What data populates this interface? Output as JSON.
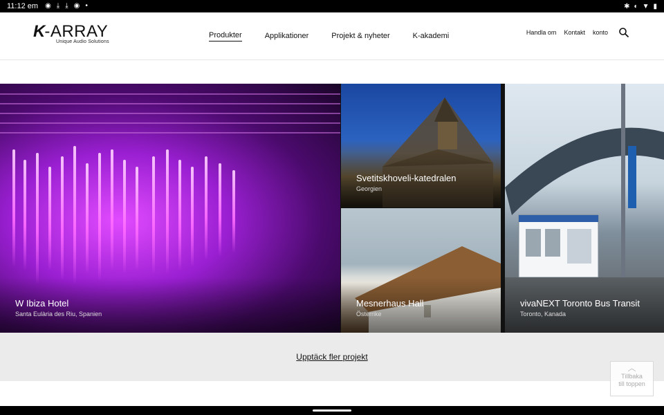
{
  "status_bar": {
    "time": "11:12 em",
    "left_icons": [
      "chrome-icon",
      "download-icon",
      "download-icon",
      "chrome-icon",
      "dot-icon"
    ],
    "right_icons": [
      "bluetooth-icon",
      "data-saver-icon",
      "wifi-icon",
      "battery-icon"
    ]
  },
  "brand": {
    "mark": "K",
    "word": "-ARRAY",
    "tagline": "Unique Audio Solutions"
  },
  "main_nav": [
    {
      "label": "Produkter",
      "active": true
    },
    {
      "label": "Applikationer",
      "active": false
    },
    {
      "label": "Projekt & nyheter",
      "active": false
    },
    {
      "label": "K-akademi",
      "active": false
    }
  ],
  "util_nav": [
    "Handla om",
    "Kontakt",
    "konto"
  ],
  "projects": [
    {
      "title": "W Ibiza Hotel",
      "location": "Santa Eulària des Riu, Spanien"
    },
    {
      "title": "Svetitskhoveli-katedralen",
      "location": "Georgien"
    },
    {
      "title": "Mesnerhaus Hall",
      "location": "Österrike"
    },
    {
      "title": "vivaNEXT Toronto Bus Transit",
      "location": "Toronto, Kanada"
    }
  ],
  "more_link": "Upptäck fler projekt",
  "back_to_top": {
    "line1": "Tillbaka",
    "line2": "till toppen"
  }
}
